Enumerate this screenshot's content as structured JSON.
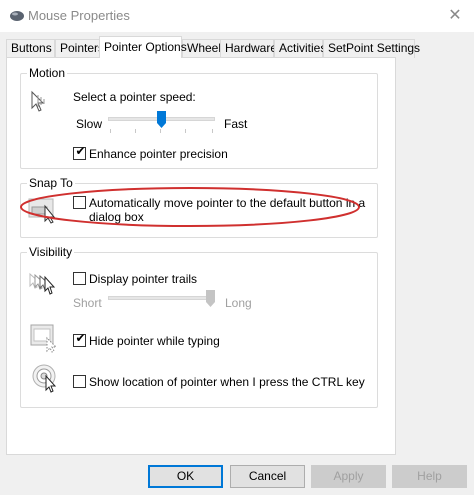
{
  "window": {
    "title": "Mouse Properties",
    "close_glyph": "✕"
  },
  "tabs": [
    {
      "label": "Buttons"
    },
    {
      "label": "Pointers"
    },
    {
      "label": "Pointer Options",
      "active": true
    },
    {
      "label": "Wheel"
    },
    {
      "label": "Hardware"
    },
    {
      "label": "Activities"
    },
    {
      "label": "SetPoint Settings"
    }
  ],
  "motion": {
    "title": "Motion",
    "speed_label": "Select a pointer speed:",
    "slow_label": "Slow",
    "fast_label": "Fast",
    "speed_level": 0.5,
    "enhance_label": "Enhance pointer precision",
    "enhance_checked": true
  },
  "snap_to": {
    "title": "Snap To",
    "auto_move_label_line1": "Automatically move pointer to the default button in a",
    "auto_move_label_line2": "dialog box",
    "auto_move_checked": false,
    "highlight_color": "#d0302f"
  },
  "visibility": {
    "title": "Visibility",
    "trails_label": "Display pointer trails",
    "trails_checked": false,
    "short_label": "Short",
    "long_label": "Long",
    "trails_level": 1.0,
    "hide_label": "Hide pointer while typing",
    "hide_checked": true,
    "ctrl_label": "Show location of pointer when I press the CTRL key",
    "ctrl_checked": false
  },
  "buttons": {
    "ok": "OK",
    "cancel": "Cancel",
    "apply": "Apply",
    "help": "Help"
  },
  "icons": [
    "mouse-icon",
    "pointer-speed-icon",
    "snap-to-icon",
    "pointer-trails-icon",
    "hide-pointer-icon",
    "ctrl-locate-icon"
  ],
  "colors": {
    "accent": "#0078d7",
    "dialog_bg": "#f0f0f0"
  }
}
